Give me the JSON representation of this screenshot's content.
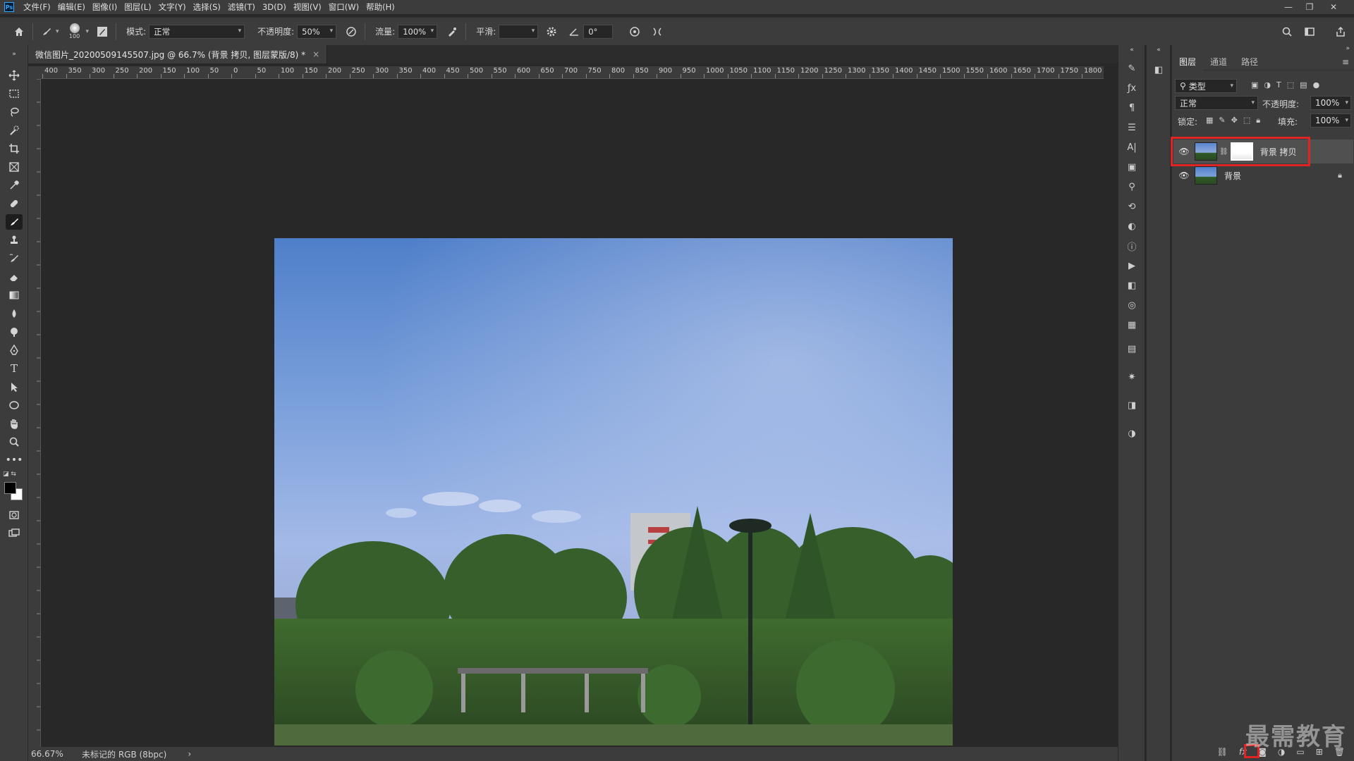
{
  "menubar": {
    "logo": "Ps",
    "items": [
      "文件(F)",
      "编辑(E)",
      "图像(I)",
      "图层(L)",
      "文字(Y)",
      "选择(S)",
      "滤镜(T)",
      "3D(D)",
      "视图(V)",
      "窗口(W)",
      "帮助(H)"
    ],
    "window_controls": [
      "minimize-icon",
      "restore-icon",
      "close-icon"
    ]
  },
  "options": {
    "brush_size": "100",
    "mode_label": "模式:",
    "mode_value": "正常",
    "opacity_label": "不透明度:",
    "opacity_value": "50%",
    "flow_label": "流量:",
    "flow_value": "100%",
    "smooth_label": "平滑:",
    "smooth_value": "",
    "angle_value": "0°"
  },
  "document": {
    "tab_title": "微信图片_20200509145507.jpg @ 66.7% (背景 拷贝, 图层蒙版/8) *",
    "close": "×",
    "zoom": "66.67%",
    "profile": "未标记的 RGB (8bpc)",
    "status_arrow": "›"
  },
  "ruler": {
    "h_labels": [
      "400",
      "350",
      "300",
      "250",
      "200",
      "150",
      "100",
      "50",
      "0",
      "50",
      "100",
      "150",
      "200",
      "250",
      "300",
      "350",
      "400",
      "450",
      "500",
      "550",
      "600",
      "650",
      "700",
      "750",
      "800",
      "850",
      "900",
      "950",
      "1000",
      "1050",
      "1100",
      "1150",
      "1200",
      "1250",
      "1300",
      "1350",
      "1400",
      "1450",
      "1500",
      "1550",
      "1600",
      "1650",
      "1700",
      "1750",
      "1800"
    ]
  },
  "layers_panel": {
    "tabs": [
      "图层",
      "通道",
      "路径"
    ],
    "filter_value": "类型",
    "blend_mode": "正常",
    "opacity_label": "不透明度:",
    "opacity_value": "100%",
    "lock_label": "锁定:",
    "fill_label": "填充:",
    "fill_value": "100%",
    "layers": [
      {
        "name": "背景 拷贝",
        "selected": true,
        "has_mask": true
      },
      {
        "name": "背景",
        "selected": false,
        "locked": true
      }
    ],
    "bottom_icons": [
      "link-icon",
      "fx-icon",
      "add-mask-icon",
      "adjustment-icon",
      "group-icon",
      "new-layer-icon",
      "trash-icon"
    ],
    "fx_label": "fx"
  },
  "watermark": "最需教育",
  "colors": {
    "highlight": "#e02424",
    "panel_bg": "#3c3c3c",
    "canvas_bg": "#282828",
    "accent": "#31a8ff"
  }
}
